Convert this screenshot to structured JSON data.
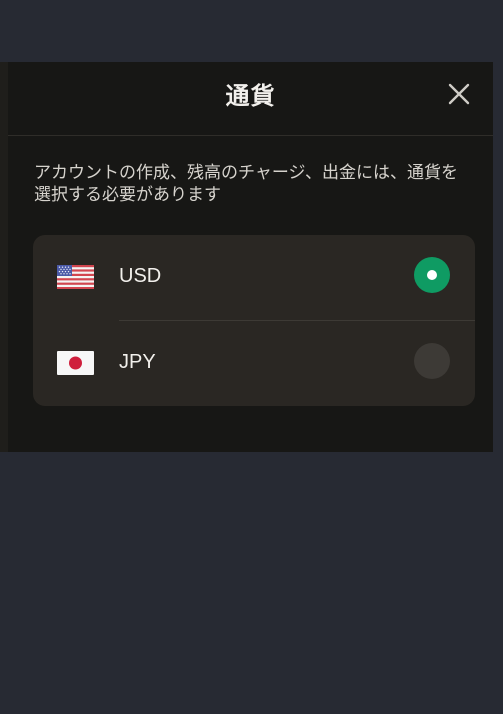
{
  "modal": {
    "title": "通貨",
    "description": "アカウントの作成、残高のチャージ、出金には、通貨を選択する必要があります"
  },
  "currencies": [
    {
      "code": "USD",
      "flag_icon": "us-flag-icon",
      "selected": true
    },
    {
      "code": "JPY",
      "flag_icon": "japan-flag-icon",
      "selected": false
    }
  ],
  "colors": {
    "backdrop": "#272a33",
    "modal_bg": "#171715",
    "list_bg": "#2a2723",
    "accent_selected": "#0f9b63",
    "radio_unselected": "#3d3a36"
  }
}
